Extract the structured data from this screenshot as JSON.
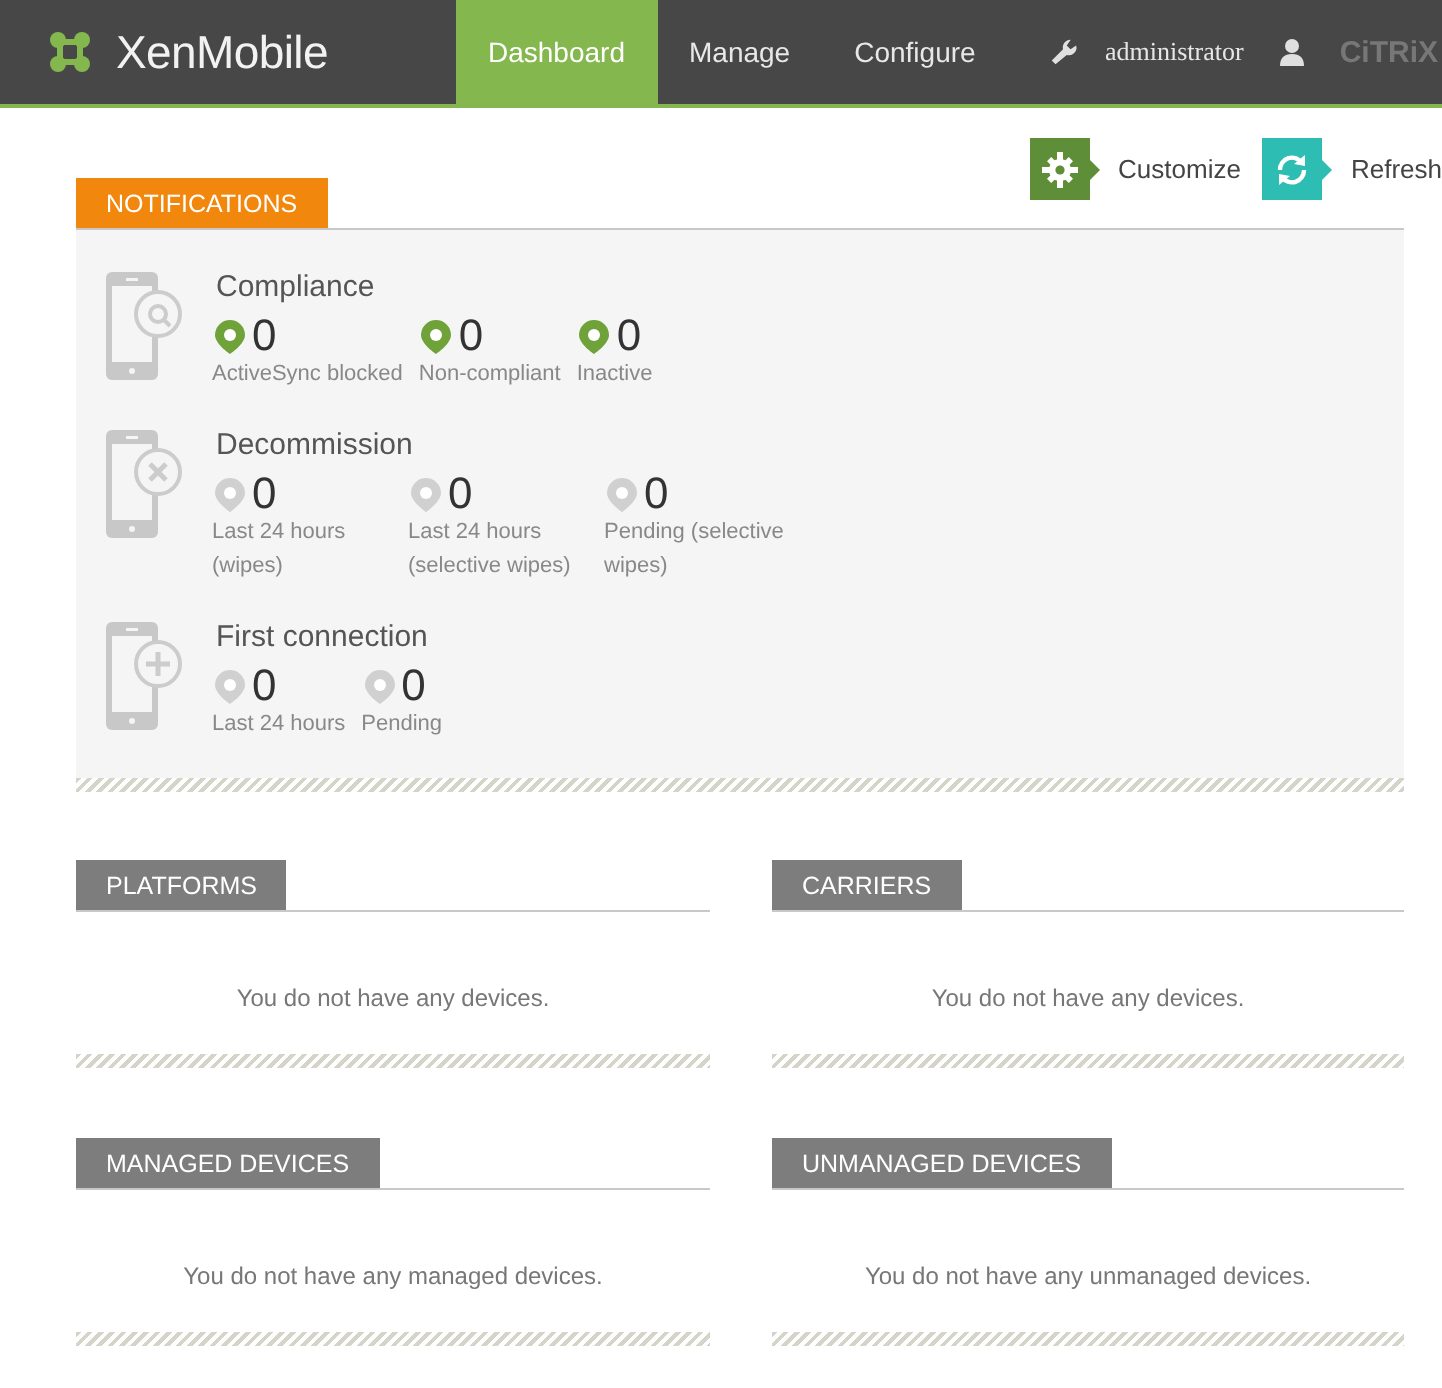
{
  "header": {
    "logo": "XenMobile",
    "nav": [
      {
        "label": "Dashboard",
        "selected": true
      },
      {
        "label": "Manage",
        "selected": false
      },
      {
        "label": "Configure",
        "selected": false
      }
    ],
    "user": "administrator",
    "brand": "CiTRiX"
  },
  "toolbar": [
    {
      "kind": "customize",
      "label": "Customize"
    },
    {
      "kind": "refresh",
      "label": "Refresh"
    }
  ],
  "notifications": {
    "title": "NOTIFICATIONS",
    "groups": [
      {
        "kind": "search",
        "title": "Compliance",
        "stats": [
          {
            "value": "0",
            "label": "ActiveSync blocked",
            "active": true
          },
          {
            "value": "0",
            "label": "Non-compliant",
            "active": true
          },
          {
            "value": "0",
            "label": "Inactive",
            "active": true
          }
        ]
      },
      {
        "kind": "remove",
        "title": "Decommission",
        "stats": [
          {
            "value": "0",
            "label": "Last 24 hours (wipes)",
            "active": false
          },
          {
            "value": "0",
            "label": "Last 24 hours (selective wipes)",
            "active": false
          },
          {
            "value": "0",
            "label": "Pending (selective wipes)",
            "active": false
          }
        ]
      },
      {
        "kind": "add",
        "title": "First connection",
        "stats": [
          {
            "value": "0",
            "label": "Last 24 hours",
            "active": false
          },
          {
            "value": "0",
            "label": "Pending",
            "active": false
          }
        ]
      }
    ]
  },
  "widgets": [
    {
      "title": "PLATFORMS",
      "message": "You do not have any devices."
    },
    {
      "title": "CARRIERS",
      "message": "You do not have any devices."
    },
    {
      "title": "MANAGED DEVICES",
      "message": "You do not have any managed devices."
    },
    {
      "title": "UNMANAGED DEVICES",
      "message": "You do not have any unmanaged devices."
    }
  ]
}
